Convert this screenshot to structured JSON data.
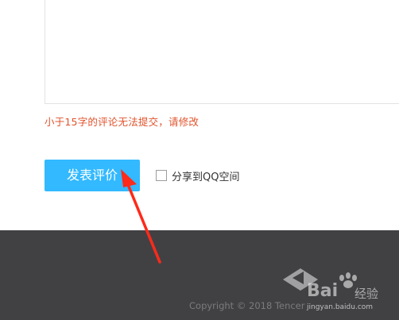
{
  "review": {
    "textarea_value": "",
    "hint": "小于15字的评论无法提交，请修改"
  },
  "actions": {
    "submit_label": "发表评价",
    "share_label": "分享到QQ空间",
    "share_checked": false
  },
  "footer": {
    "copyright_visible": "Copyright © 2018 Tencer"
  },
  "watermark": {
    "brand": "Bai",
    "brand_suffix": "经验",
    "url": "jingyan.baidu.com"
  },
  "colors": {
    "accent_button": "#33b9ff",
    "hint_red": "#e0532c",
    "footer_bg": "#414144",
    "annotation_arrow": "#ff2a1a"
  }
}
